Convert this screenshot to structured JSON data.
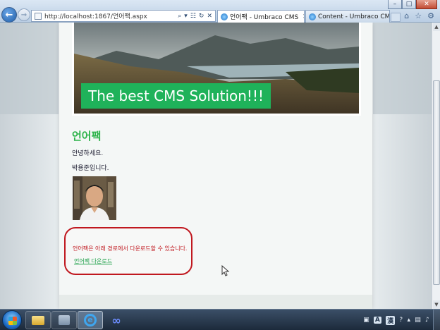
{
  "browser": {
    "address_url": "http://localhost:1867/언어팩.aspx",
    "tabs": [
      {
        "label": "언어팩 - Umbraco CMS",
        "active": true
      },
      {
        "label": "Content - Umbraco CMS - lo...",
        "active": false
      }
    ],
    "window_controls": {
      "minimize": "–",
      "maximize": "□",
      "close": "✕"
    }
  },
  "page": {
    "banner_caption": "The best CMS Solution!!!",
    "heading": "언어팩",
    "paragraph_1": "안녕하세요.",
    "paragraph_2": "박용준입니다.",
    "notice_text": "언어팩은 아래 경로에서 다운로드할 수 있습니다.",
    "notice_link": "언어팩 다운로드"
  },
  "taskbar": {
    "ime_mode": "A",
    "ime_lang": "漢"
  },
  "colors": {
    "accent_green": "#1fb25a",
    "notice_red": "#c0181f",
    "link_green": "#1fa04a"
  }
}
